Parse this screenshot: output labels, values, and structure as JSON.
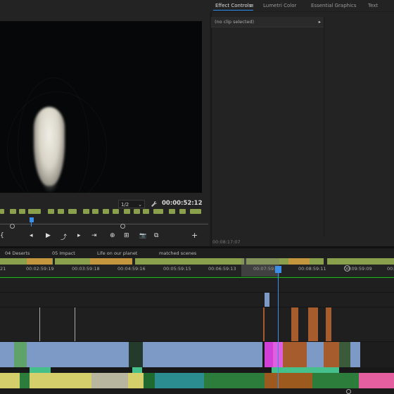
{
  "program_monitor": {
    "fit_value": "1/2",
    "fit_arrow": "⌄",
    "timecode": "00:00:52:12",
    "wrench_icon": "wrench-icon",
    "controls": [
      "{",
      "◂",
      "▶",
      "⤴",
      "▸",
      "⇥",
      "⊕",
      "⊞",
      "📷",
      "⧉",
      "+"
    ]
  },
  "effect_panel": {
    "tabs": [
      "Effect Controls",
      "≡",
      "Lumetri Color",
      "Essential Graphics",
      "Text"
    ],
    "no_clip": "(no clip selected)",
    "expand_icon": "▸",
    "timecode": "00:08:17:07"
  },
  "sequence_tabs": [
    "04 Deserts",
    "05 Impact",
    "Life on our planet",
    "matched scenes"
  ],
  "ruler": {
    "labels": [
      "21",
      "00:02:59:19",
      "00:03:59:18",
      "00:04:59:16",
      "00:05:59:15",
      "00:06:59:13",
      "00:07:59:12",
      "00:08:59:11",
      "00:09:59:09",
      "00:"
    ]
  },
  "colors": {
    "accent_blue": "#3d8ee8",
    "marker_green": "#8aa04c",
    "marker_orange": "#c4973f",
    "video_clip_blue": "#7d9ac7",
    "video_clip_orange": "#a65c2c",
    "audio_green": "#2c7d3c",
    "audio_yellow": "#d4cf6a",
    "magenta": "#d13fd6"
  }
}
